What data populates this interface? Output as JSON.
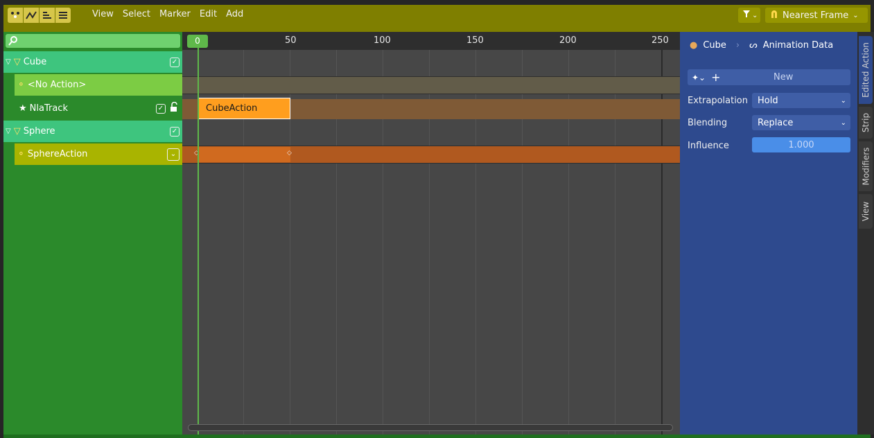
{
  "header": {
    "editor_icons": [
      "nla-editor-icon",
      "graph-editor-icon",
      "drivers-editor-icon",
      "dopesheet-editor-icon"
    ],
    "menus": [
      "View",
      "Select",
      "Marker",
      "Edit",
      "Add"
    ],
    "snapping_label": "Nearest Frame"
  },
  "channels": {
    "items": [
      {
        "label": "Cube",
        "checked": true
      },
      {
        "label": "<No Action>"
      },
      {
        "label": "NlaTrack",
        "checked": true
      },
      {
        "label": "Sphere",
        "checked": true
      },
      {
        "label": "SphereAction"
      }
    ]
  },
  "timeline": {
    "current_frame": "0",
    "ruler_labels": [
      "50",
      "100",
      "150",
      "200",
      "250"
    ],
    "strip_label": "CubeAction"
  },
  "properties": {
    "breadcrumb_object": "Cube",
    "breadcrumb_data": "Animation Data",
    "new_button": "New",
    "extrapolation_label": "Extrapolation",
    "extrapolation_value": "Hold",
    "blending_label": "Blending",
    "blending_value": "Replace",
    "influence_label": "Influence",
    "influence_value": "1.000"
  },
  "side_tabs": [
    "Edited Action",
    "Strip",
    "Modifiers",
    "View"
  ],
  "colors": {
    "header": "#7f7f00",
    "channel_bg": "#2b8a2b",
    "object_row": "#3ec57e",
    "action_row_empty": "#7ccc44",
    "action_row": "#a9b400",
    "strip": "#ff9e1e",
    "panel": "#2e4a8e"
  }
}
